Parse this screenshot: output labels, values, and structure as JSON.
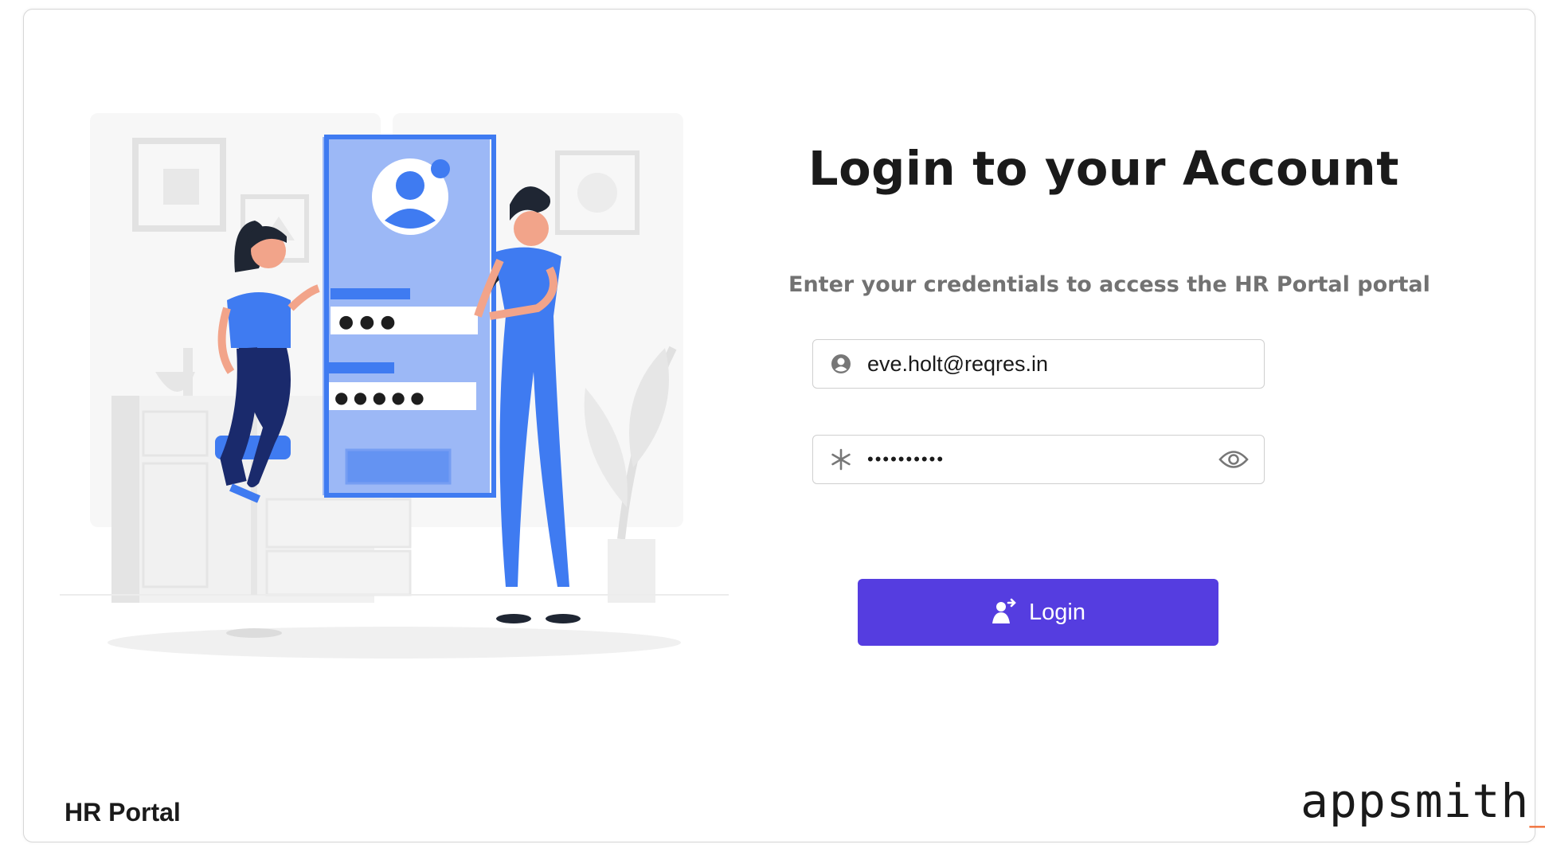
{
  "login": {
    "title": "Login to your Account",
    "subtitle": "Enter your credentials to access the HR Portal portal",
    "email_value": "eve.holt@reqres.in",
    "password_value": "••••••••••",
    "login_label": "Login"
  },
  "footer": {
    "app_name": "HR Portal",
    "brand": "appsmith",
    "brand_cursor": "_"
  },
  "illustration": {
    "password_dots_1": "● ● ●",
    "password_dots_2": "● ● ● ● ●"
  },
  "icons": {
    "email": "user-circle-icon",
    "password": "asterisk-icon",
    "visibility": "eye-icon",
    "login": "log-in-user-icon"
  },
  "colors": {
    "primary": "#553de0",
    "illustration_blue": "#3f7bf1",
    "brand_accent": "#f06a30"
  }
}
